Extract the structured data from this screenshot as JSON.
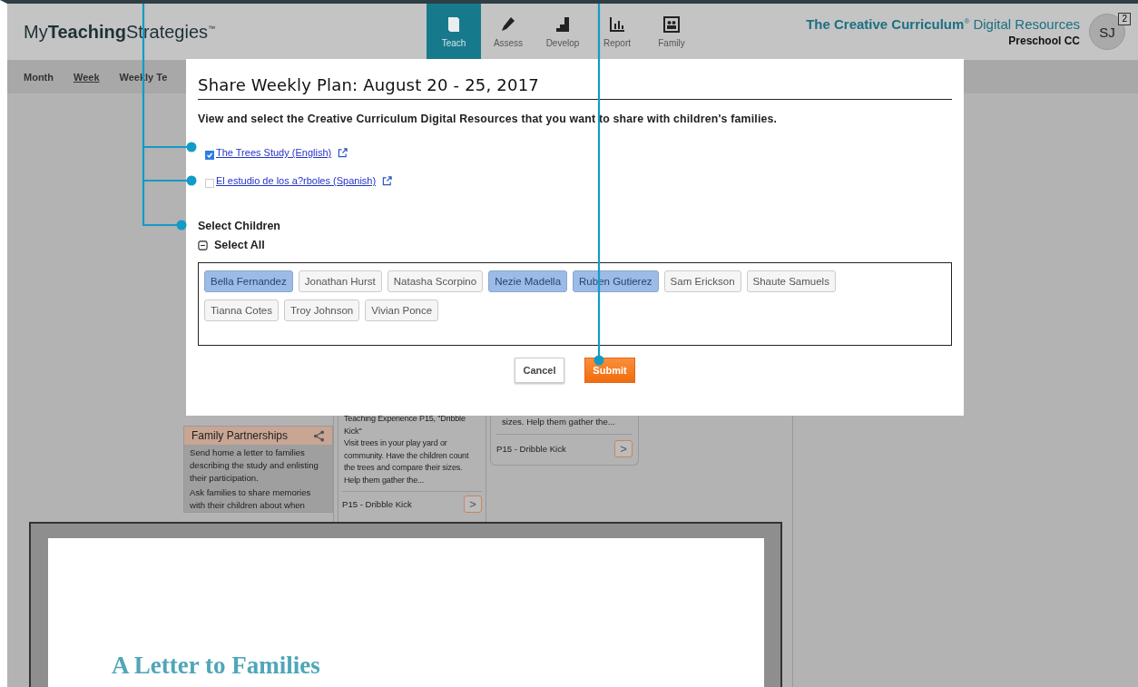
{
  "header": {
    "logo": "My**Teaching**Strategies$^{™}$",
    "nav": [
      {
        "label": "Teach",
        "selected": true
      },
      {
        "label": "Assess",
        "selected": false
      },
      {
        "label": "Develop",
        "selected": false
      },
      {
        "label": "Report",
        "selected": false
      },
      {
        "label": "Family",
        "selected": false
      }
    ],
    "product": "**The Creative Curriculum**$^{®}$ Digital Resources",
    "program": "Preschool CC",
    "avatar": {
      "initials": "SJ",
      "badge": "2"
    }
  },
  "subnav": [
    {
      "label": "Month",
      "selected": false
    },
    {
      "label": "Week",
      "selected": true
    },
    {
      "label": "Weekly Te",
      "selected": false
    }
  ],
  "cards": {
    "family": {
      "title": "Family Partnerships",
      "paragraphs": [
        "Send home a letter to families describing the study and enlisting their participation.",
        "Ask families to share memories with their children about when"
      ]
    },
    "middle": {
      "paragraphs": [
        "Teaching Experience P15, \"Dribble Kick\"",
        "Visit trees in your play yard or community. Have the children count the trees and compare their sizes. Help them gather the..."
      ],
      "footer": "P15 - Dribble Kick",
      "arrow": ">"
    },
    "right": {
      "paragraphs": [
        "sizes. Help them gather the..."
      ],
      "footer": "P15 - Dribble Kick",
      "arrow": ">"
    }
  },
  "dialog": {
    "title": "Share Weekly Plan: August 20 - 25, 2017",
    "description": "View and select the Creative Curriculum Digital Resources that you want to share with children's families.",
    "resources": [
      {
        "label": "The Trees Study (English)",
        "checked": true
      },
      {
        "label": "El estudio de los a?rboles (Spanish)",
        "checked": false
      }
    ],
    "children_heading": "Select Children",
    "select_all": "Select All",
    "children": [
      {
        "name": "Bella Fernandez",
        "selected": true
      },
      {
        "name": "Jonathan Hurst",
        "selected": false
      },
      {
        "name": "Natasha Scorpino",
        "selected": false
      },
      {
        "name": "Nezie Madella",
        "selected": true
      },
      {
        "name": "Ruben Gutierez",
        "selected": true
      },
      {
        "name": "Sam Erickson",
        "selected": false
      },
      {
        "name": "Shaute Samuels",
        "selected": false
      },
      {
        "name": "Tianna Cotes",
        "selected": false
      },
      {
        "name": "Troy Johnson",
        "selected": false
      },
      {
        "name": "Vivian Ponce",
        "selected": false
      }
    ],
    "buttons": {
      "cancel": "Cancel",
      "submit": "Submit"
    }
  },
  "letter_preview": {
    "heading": "A Letter to Families"
  }
}
